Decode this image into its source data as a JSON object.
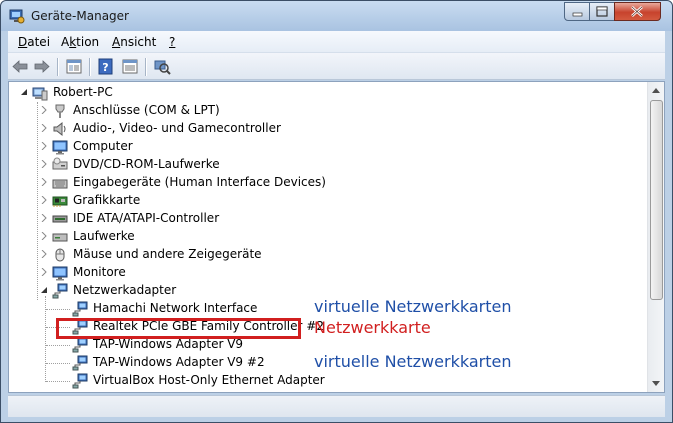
{
  "window": {
    "title": "Geräte-Manager"
  },
  "menu": [
    {
      "label": "Datei",
      "underline_index": 0
    },
    {
      "label": "Aktion",
      "underline_index": 1
    },
    {
      "label": "Ansicht",
      "underline_index": 0
    },
    {
      "label": "?",
      "underline_index": 0
    }
  ],
  "toolbar": {
    "icons": [
      "back-arrow-icon",
      "forward-arrow-icon",
      "properties-view-icon",
      "help-icon",
      "details-view-icon",
      "scan-hardware-icon"
    ]
  },
  "tree": {
    "root": {
      "label": "Robert-PC",
      "expanded": true,
      "icon": "computer-icon"
    },
    "categories": [
      {
        "label": "Anschlüsse (COM & LPT)",
        "icon": "port-icon",
        "expanded": false
      },
      {
        "label": "Audio-, Video- und Gamecontroller",
        "icon": "speaker-icon",
        "expanded": false
      },
      {
        "label": "Computer",
        "icon": "monitor-icon",
        "expanded": false
      },
      {
        "label": "DVD/CD-ROM-Laufwerke",
        "icon": "dvd-drive-icon",
        "expanded": false
      },
      {
        "label": "Eingabegeräte (Human Interface Devices)",
        "icon": "keyboard-icon",
        "expanded": false
      },
      {
        "label": "Grafikkarte",
        "icon": "graphics-card-icon",
        "expanded": false
      },
      {
        "label": "IDE ATA/ATAPI-Controller",
        "icon": "ide-controller-icon",
        "expanded": false
      },
      {
        "label": "Laufwerke",
        "icon": "hard-disk-icon",
        "expanded": false
      },
      {
        "label": "Mäuse und andere Zeigegeräte",
        "icon": "mouse-icon",
        "expanded": false
      },
      {
        "label": "Monitore",
        "icon": "monitor-icon",
        "expanded": false
      },
      {
        "label": "Netzwerkadapter",
        "icon": "network-adapter-icon",
        "expanded": true,
        "children": [
          {
            "label": "Hamachi Network Interface",
            "icon": "network-adapter-icon"
          },
          {
            "label": "Realtek PCIe GBE Family Controller #2",
            "icon": "network-adapter-icon",
            "highlighted": true
          },
          {
            "label": "TAP-Windows Adapter V9",
            "icon": "network-adapter-icon"
          },
          {
            "label": "TAP-Windows Adapter V9 #2",
            "icon": "network-adapter-icon"
          },
          {
            "label": "VirtualBox Host-Only Ethernet Adapter",
            "icon": "network-adapter-icon"
          }
        ]
      }
    ]
  },
  "annotations": {
    "virtual_1": "virtuelle Netzwerkkarten",
    "physical": "Netzwerkkarte",
    "virtual_2": "virtuelle Netzwerkkarten"
  },
  "colors": {
    "annotation_blue": "#1f4fa7",
    "annotation_red": "#d11f1f",
    "titlebar": "#bcd0e6"
  }
}
